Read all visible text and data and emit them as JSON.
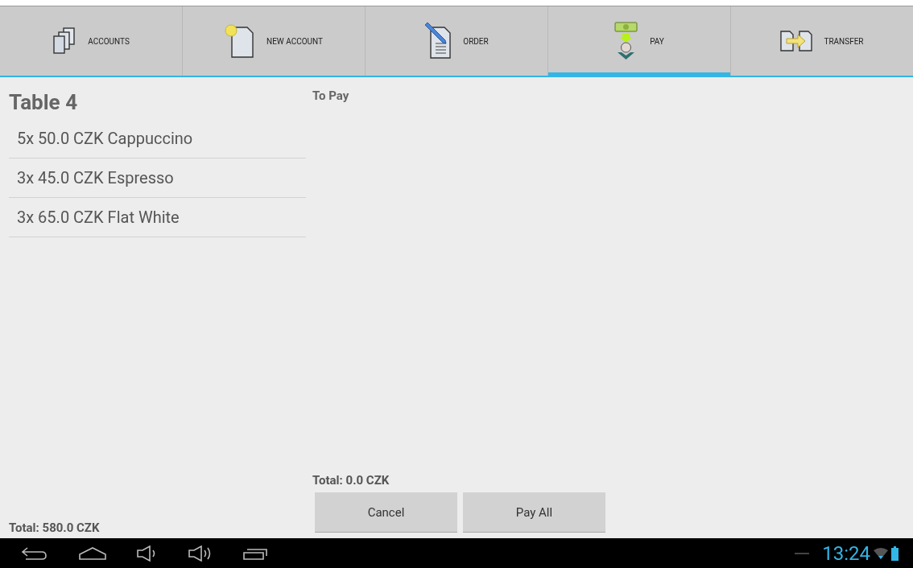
{
  "tabs": [
    {
      "label": "ACCOUNTS",
      "selected": false
    },
    {
      "label": "NEW ACCOUNT",
      "selected": false
    },
    {
      "label": "ORDER",
      "selected": false
    },
    {
      "label": "PAY",
      "selected": true
    },
    {
      "label": "TRANSFER",
      "selected": false
    }
  ],
  "account": {
    "title": "Table 4",
    "items": [
      "5x 50.0 CZK Cappuccino",
      "3x 45.0 CZK Espresso",
      "3x 65.0 CZK Flat White"
    ],
    "total": "Total: 580.0 CZK"
  },
  "to_pay": {
    "title": "To Pay",
    "total": "Total: 0.0 CZK",
    "buttons": [
      "Cancel",
      "Pay All"
    ]
  },
  "status_bar": {
    "time": "13:24"
  }
}
